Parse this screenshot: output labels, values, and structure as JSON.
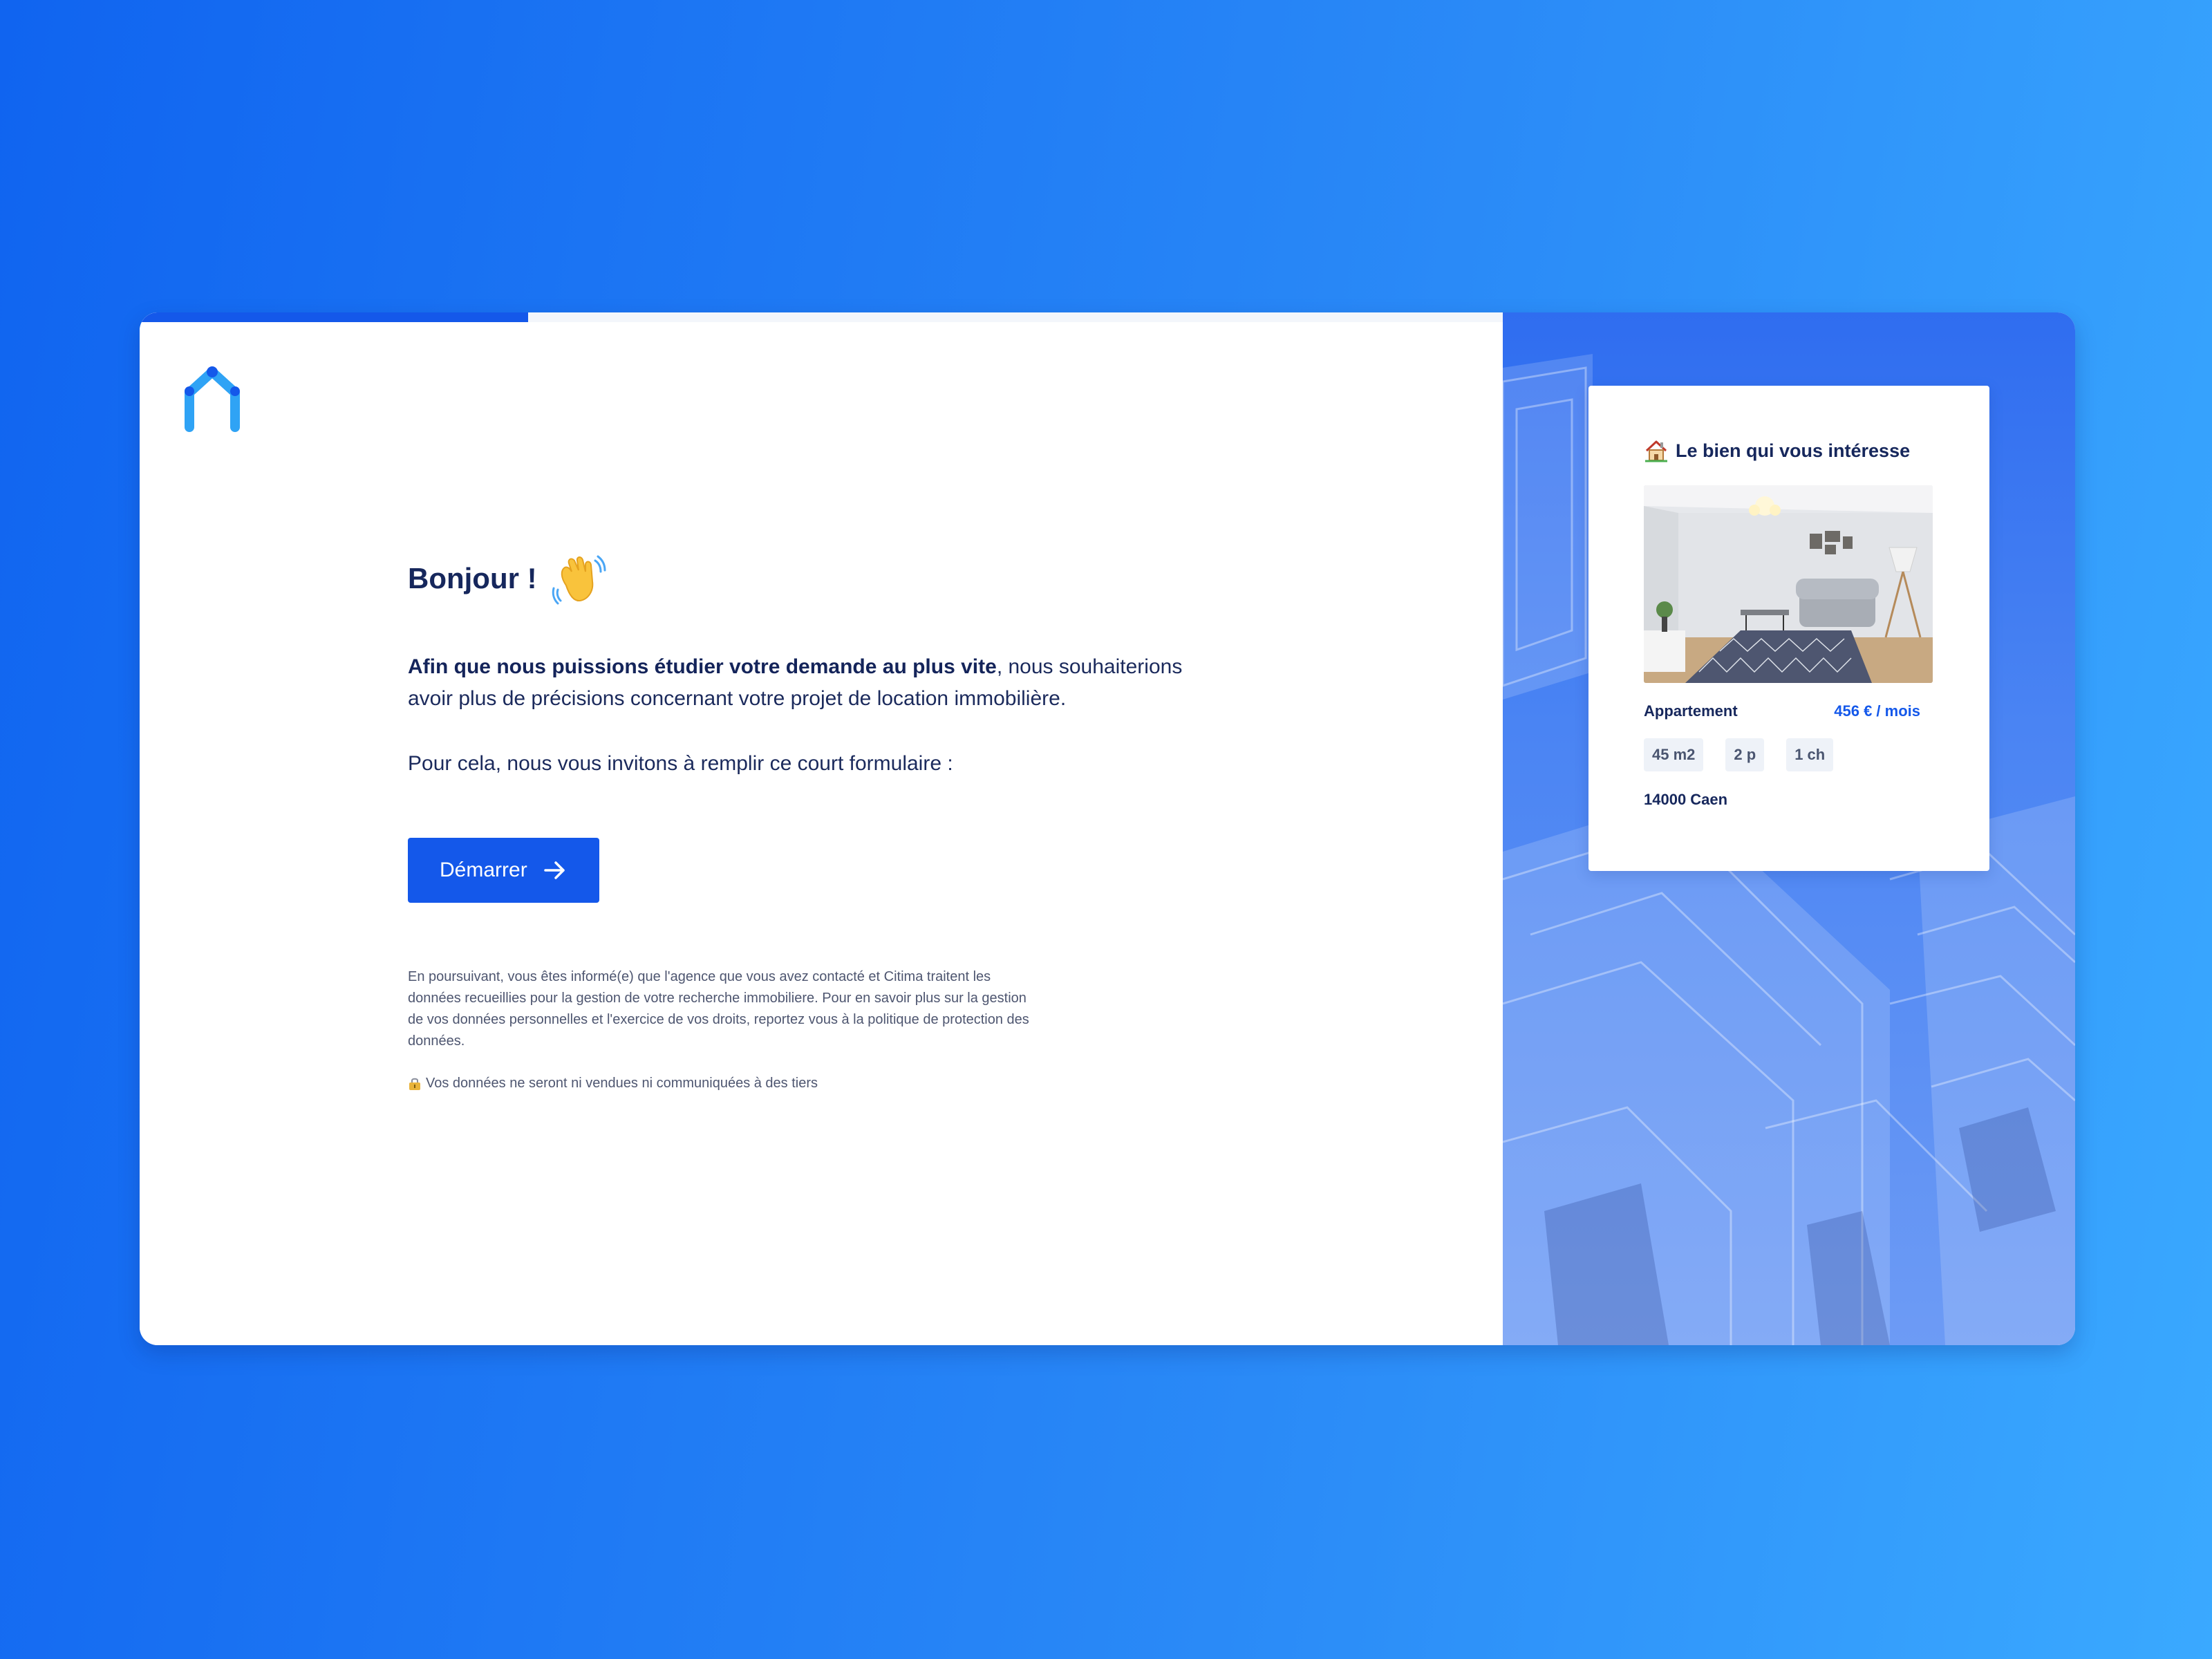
{
  "progress": {
    "fraction": 0.285
  },
  "brand": {
    "logo_icon": "house-arch-logo-icon"
  },
  "welcome": {
    "greeting": "Bonjour !",
    "greeting_icon": "waving-hand-icon",
    "intro_bold": "Afin que nous puissions étudier votre demande au plus vite",
    "intro_rest": ", nous souhaiterions avoir plus de précisions concernant votre projet de location immobilière.",
    "invite": "Pour cela, nous vous invitons à remplir ce court formulaire :",
    "start_label": "Démarrer",
    "start_icon": "arrow-right-icon",
    "legal": "En poursuivant, vous êtes informé(e) que l'agence que vous avez contacté et Citima traitent les données recueillies pour la gestion de votre recherche immobiliere. Pour en savoir plus sur la gestion de vos données personnelles et l'exercice de vos droits, reportez vous à la politique de protection des données.",
    "privacy_icon": "lock-icon",
    "privacy_note": "Vos données ne seront ni vendues ni communiquées à des tiers"
  },
  "property": {
    "heading_icon": "house-icon",
    "heading": "Le bien qui vous intéresse",
    "photo": "living-room-photo",
    "type": "Appartement",
    "price": "456 € / mois",
    "chips": [
      "45 m2",
      "2 p",
      "1 ch"
    ],
    "city": "14000 Caen"
  },
  "colors": {
    "accent": "#1458ea",
    "text_dark": "#16275c",
    "chip_bg": "#eef2f8"
  }
}
